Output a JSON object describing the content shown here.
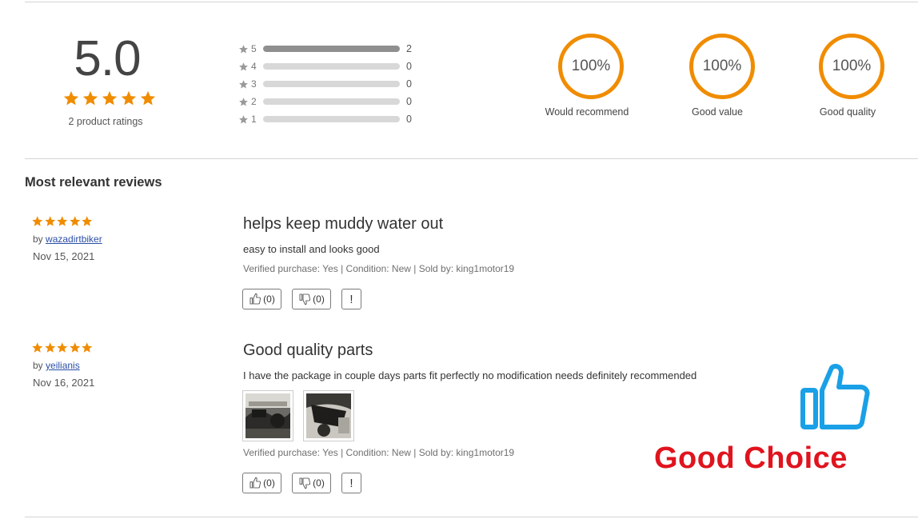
{
  "summary": {
    "average": "5.0",
    "ratings_count_label": "2 product ratings",
    "histogram": [
      {
        "level": "5",
        "count": "2",
        "fraction": 1.0
      },
      {
        "level": "4",
        "count": "0",
        "fraction": 0
      },
      {
        "level": "3",
        "count": "0",
        "fraction": 0
      },
      {
        "level": "2",
        "count": "0",
        "fraction": 0
      },
      {
        "level": "1",
        "count": "0",
        "fraction": 0
      }
    ],
    "attributes": [
      {
        "percent": "100%",
        "label": "Would recommend"
      },
      {
        "percent": "100%",
        "label": "Good value"
      },
      {
        "percent": "100%",
        "label": "Good quality"
      }
    ]
  },
  "reviews_heading": "Most relevant reviews",
  "reviews": [
    {
      "rating": 5,
      "by_prefix": "by",
      "author": "wazadirtbiker",
      "date": "Nov 15, 2021",
      "title": "helps keep muddy water out",
      "body": "easy to install and looks good",
      "meta": "Verified purchase: Yes | Condition: New | Sold by: king1motor19",
      "helpful": "(0)",
      "unhelpful": "(0)",
      "report": "!"
    },
    {
      "rating": 5,
      "by_prefix": "by",
      "author": "yeilianis",
      "date": "Nov 16, 2021",
      "title": "Good quality parts",
      "body": "I have the package in couple days parts fit perfectly no modification needs definitely recommended",
      "meta": "Verified purchase: Yes | Condition: New | Sold by: king1motor19",
      "helpful": "(0)",
      "unhelpful": "(0)",
      "report": "!"
    }
  ],
  "promo": {
    "text": "Good Choice",
    "icon": "thumbs-up-icon"
  },
  "colors": {
    "star": "#f08c00",
    "ring": "#f08c00",
    "promo_text": "#e0141e",
    "promo_icon": "#1aa0e6",
    "link": "#2a4ea6"
  }
}
